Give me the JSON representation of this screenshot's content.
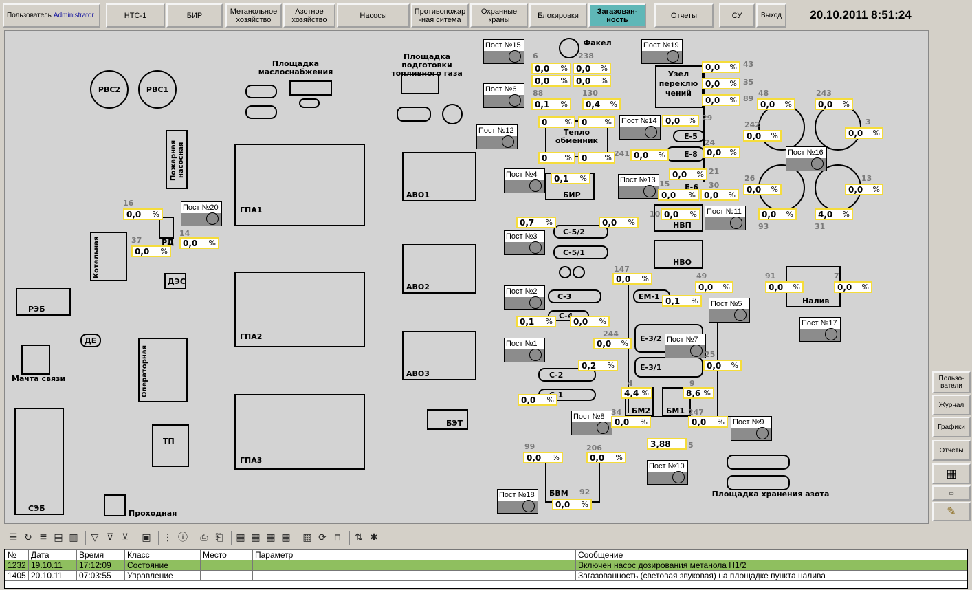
{
  "topbar": {
    "user_label": "Пользователь",
    "user_name": "Administrator",
    "buttons": [
      "НТС-1",
      "БИР",
      "Метанольное\nхозяйство",
      "Азотное\nхозяйство",
      "Насосы",
      "Противопожар\n-ная ситема",
      "Охранные\nкраны",
      "Блокировки",
      "Загазован-\nность",
      "Отчеты",
      "СУ",
      "Выход"
    ],
    "active": "Загазован-\nность",
    "clock": "20.10.2011 8:51:24"
  },
  "sidebar": [
    "Пользо-\nватели",
    "Журнал",
    "Графики",
    "Отчёты"
  ],
  "map": {
    "labels": {
      "rvc2": "РВС2",
      "rvc1": "РВС1",
      "oil_area": "Площадка\nмаслоснабжения",
      "fuel_gas": "Площадка подготовки\nтопливного газа",
      "fakel": "Факел",
      "fire_pump": "Пожарная\nнасосная",
      "gpa1": "ГПА1",
      "gpa2": "ГПА2",
      "gpa3": "ГПА3",
      "avo1": "АВО1",
      "avo2": "АВО2",
      "avo3": "АВО3",
      "bet": "БЭТ",
      "kotelnaya": "Котельная",
      "rd": "РД",
      "des": "ДЭС",
      "reb": "РЭБ",
      "de": "ДЕ",
      "mast": "Мачта связи",
      "operator": "Операторная",
      "tp": "ТП",
      "seb": "СЭБ",
      "prohod": "Проходная",
      "uzel": "Узел\nпереклю\nчений",
      "teplo": "Тепло\nобменник",
      "e5": "Е-5",
      "e8": "Е-8",
      "e6": "Е-6",
      "nvp": "НВП",
      "nvo": "НВО",
      "bir": "БИР",
      "c52": "С-5/2",
      "c51": "С-5/1",
      "c3": "С-3",
      "c4": "С-4",
      "c2": "С-2",
      "c1": "С-1",
      "em1": "ЕМ-1",
      "e32": "Е-3/2",
      "e31": "Е-3/1",
      "bm2": "БМ2",
      "bm1": "БМ1",
      "bvm": "БВМ",
      "naliv": "Налив",
      "nitrogen": "Площадка хранения азота"
    },
    "posts": {
      "p15": "Пост №15",
      "p19": "Пост №19",
      "p6": "Пост №6",
      "p12": "Пост №12",
      "p14": "Пост №14",
      "p16": "Пост №16",
      "p4": "Пост №4",
      "p13": "Пост №13",
      "p20": "Пост №20",
      "p11": "Пост №11",
      "p3": "Пост №3",
      "p2": "Пост №2",
      "p5": "Пост №5",
      "p17": "Пост №17",
      "p1": "Пост №1",
      "p7": "Пост №7",
      "p8": "Пост №8",
      "p9": "Пост №9",
      "p10": "Пост №10",
      "p18": "Пост №18"
    },
    "values": {
      "v6": "0,0",
      "v238": "0,0",
      "v43": "0,0",
      "v35": "0,0",
      "v5a": "0,0",
      "v5b": "0,0",
      "v88": "0,1",
      "v130": "0,4",
      "v89": "0,0",
      "v48": "0,0",
      "v243": "0,0",
      "vt1": "0",
      "vt2": "0",
      "v29": "0,0",
      "v242": "0,0",
      "v3": "0,0",
      "vt3": "0",
      "vt4": "0",
      "v241": "0,0",
      "v24": "0,0",
      "vbir": "0,1",
      "v21": "0,0",
      "v15": "0,0",
      "v30": "0,0",
      "v26": "0,0",
      "v13": "0,0",
      "v16": "0,0",
      "v14": "0,0",
      "v10": "0,0",
      "v93": "0,0",
      "v31": "4,0",
      "v37": "0,0",
      "vc1": "0,7",
      "vc2": "0,0",
      "v147": "0,0",
      "v49": "0,0",
      "v91": "0,0",
      "v7": "0,0",
      "vem": "0,1",
      "vc4a": "0,1",
      "vc4b": "0,0",
      "v244": "0,0",
      "v25": "0,0",
      "vc2b": "0,2",
      "vc1b": "0,0",
      "v4": "4,4",
      "v9": "8,6",
      "v34": "0,0",
      "v247": "0,0",
      "v388": "3,88",
      "v99": "0,0",
      "v206": "0,0",
      "v92": "0,0"
    },
    "unit": "%",
    "numbers": {
      "n6": "6",
      "n238": "238",
      "n43": "43",
      "n35": "35",
      "n88": "88",
      "n130": "130",
      "n89": "89",
      "n48": "48",
      "n243": "243",
      "n29": "29",
      "n242": "242",
      "n3": "3",
      "n24": "24",
      "n241": "241",
      "n21": "21",
      "n15": "15",
      "n30": "30",
      "n26": "26",
      "n13": "13",
      "n16": "16",
      "n14": "14",
      "n10": "10",
      "n93": "93",
      "n31": "31",
      "n37": "37",
      "n147": "147",
      "n49": "49",
      "n91": "91",
      "n7": "7",
      "n244": "244",
      "n25": "25",
      "n4": "4",
      "n9": "9",
      "n34": "34",
      "n247": "247",
      "n5": "5",
      "n99": "99",
      "n206": "206",
      "n92": "92"
    }
  },
  "log": {
    "headers": [
      "№",
      "Дата",
      "Время",
      "Класс",
      "Место",
      "Параметр",
      "Сообщение"
    ],
    "rows": [
      [
        "1232",
        "19.10.11",
        "17:12:09",
        "Состояние",
        "",
        "",
        "Включен насос дозирования метанола Н1/2"
      ],
      [
        "1405",
        "20.10.11",
        "07:03:55",
        "Управление",
        "",
        "",
        "Загазованность (световая звуковая) на площадке пункта налива"
      ]
    ]
  }
}
